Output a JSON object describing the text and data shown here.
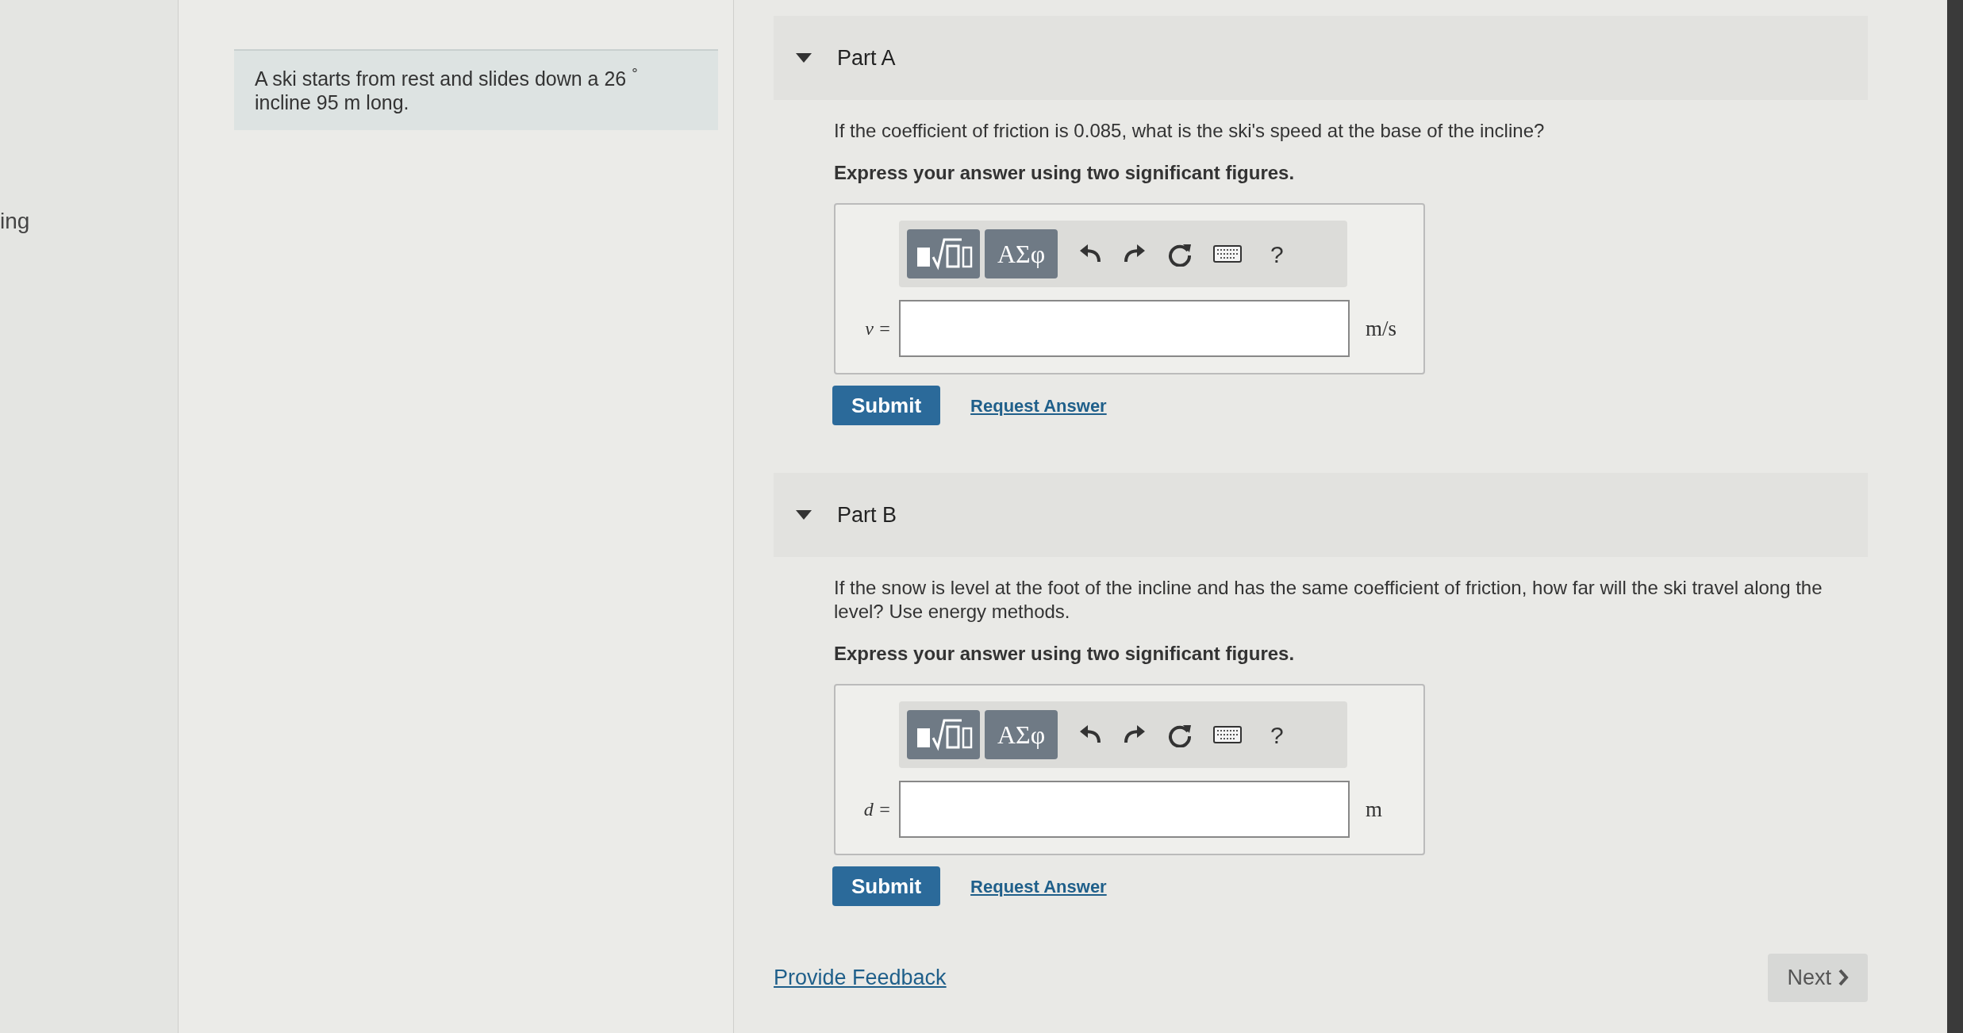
{
  "sidebar": {
    "text": "ing"
  },
  "problem": {
    "text": "A ski starts from rest and slides down a 26 $^{°}$ incline 95 m long."
  },
  "parts": [
    {
      "title": "Part A",
      "expanded": true,
      "question": "If the coefficient of friction is 0.085, what is the ski's speed at the base of the incline?",
      "instruction": "Express your answer using two significant figures.",
      "greek": "ΑΣφ",
      "help": "?",
      "variable": "v =",
      "unit": "m/s",
      "submit": "Submit",
      "request": "Request Answer"
    },
    {
      "title": "Part B",
      "expanded": true,
      "question": "If the snow is level at the foot of the incline and has the same coefficient of friction, how far will the ski travel along the level? Use energy methods.",
      "instruction": "Express your answer using two significant figures.",
      "greek": "ΑΣφ",
      "help": "?",
      "variable": "d =",
      "unit": "m",
      "submit": "Submit",
      "request": "Request Answer"
    }
  ],
  "feedback": "Provide Feedback",
  "next": "Next"
}
